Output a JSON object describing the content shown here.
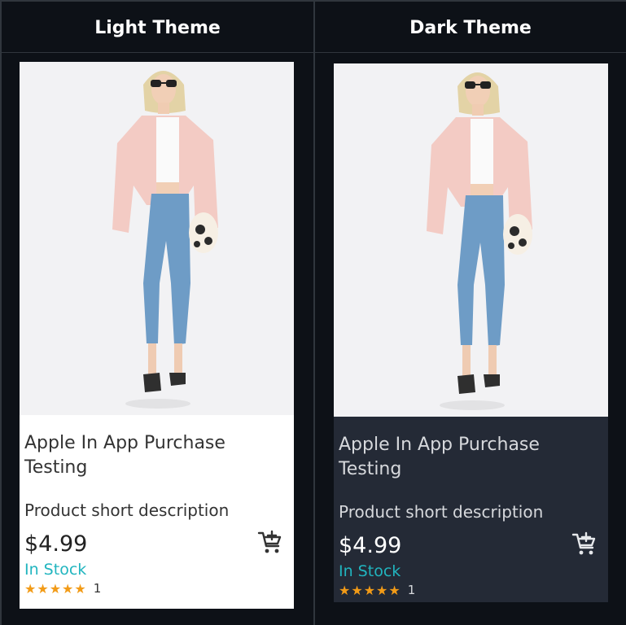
{
  "headers": {
    "light": "Light Theme",
    "dark": "Dark Theme"
  },
  "product": {
    "title": "Apple In App Purchase Testing",
    "description": "Product short description",
    "price": "$4.99",
    "stock": "In Stock",
    "stars": "★★★★★",
    "rating_value": 5,
    "rating_count": "1"
  },
  "icons": {
    "cart": "add-to-cart-icon",
    "star": "star-icon"
  },
  "colors": {
    "background": "#0d1117",
    "light_card": "#ffffff",
    "dark_card": "#242a36",
    "stock": "#21b5bf",
    "star": "#f29b17"
  }
}
